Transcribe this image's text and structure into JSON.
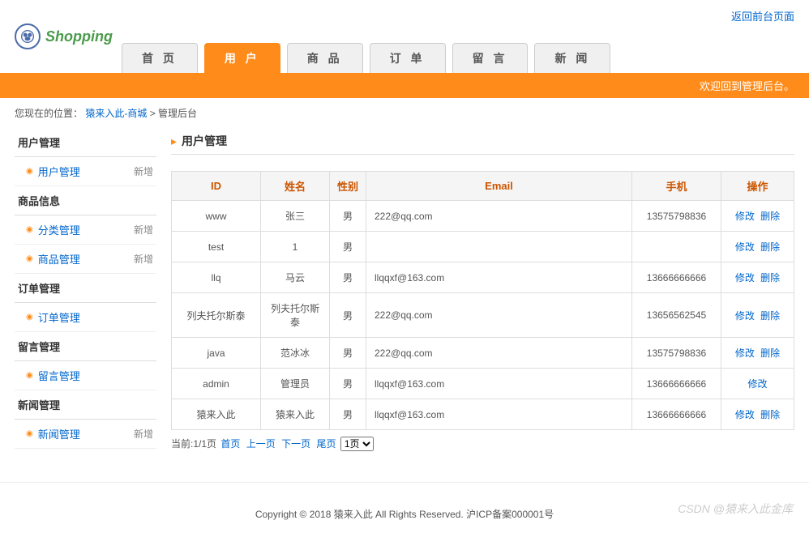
{
  "topLink": "返回前台页面",
  "logo": {
    "text": "Shopping"
  },
  "nav": {
    "tabs": [
      {
        "label": "首 页",
        "active": false
      },
      {
        "label": "用 户",
        "active": true
      },
      {
        "label": "商 品",
        "active": false
      },
      {
        "label": "订 单",
        "active": false
      },
      {
        "label": "留 言",
        "active": false
      },
      {
        "label": "新 闻",
        "active": false
      }
    ]
  },
  "welcomeBar": "欢迎回到管理后台。",
  "breadcrumb": {
    "prefix": "您现在的位置：",
    "link": "猿来入此-商城",
    "sep": " > ",
    "current": "管理后台"
  },
  "sidebar": [
    {
      "title": "用户管理",
      "items": [
        {
          "label": "用户管理",
          "add": "新增"
        }
      ]
    },
    {
      "title": "商品信息",
      "items": [
        {
          "label": "分类管理",
          "add": "新增"
        },
        {
          "label": "商品管理",
          "add": "新增"
        }
      ]
    },
    {
      "title": "订单管理",
      "items": [
        {
          "label": "订单管理",
          "add": ""
        }
      ]
    },
    {
      "title": "留言管理",
      "items": [
        {
          "label": "留言管理",
          "add": ""
        }
      ]
    },
    {
      "title": "新闻管理",
      "items": [
        {
          "label": "新闻管理",
          "add": "新增"
        }
      ]
    }
  ],
  "pageTitle": "用户管理",
  "table": {
    "headers": [
      "ID",
      "姓名",
      "性别",
      "Email",
      "手机",
      "操作"
    ],
    "rows": [
      {
        "id": "www",
        "name": "张三",
        "gender": "男",
        "email": "222@qq.com",
        "phone": "13575798836",
        "ops": [
          "修改",
          "删除"
        ]
      },
      {
        "id": "test",
        "name": "1",
        "gender": "男",
        "email": "",
        "phone": "",
        "ops": [
          "修改",
          "删除"
        ]
      },
      {
        "id": "llq",
        "name": "马云",
        "gender": "男",
        "email": "llqqxf@163.com",
        "phone": "13666666666",
        "ops": [
          "修改",
          "删除"
        ]
      },
      {
        "id": "列夫托尔斯泰",
        "name": "列夫托尔斯泰",
        "gender": "男",
        "email": "222@qq.com",
        "phone": "13656562545",
        "ops": [
          "修改",
          "删除"
        ]
      },
      {
        "id": "java",
        "name": "范冰冰",
        "gender": "男",
        "email": "222@qq.com",
        "phone": "13575798836",
        "ops": [
          "修改",
          "删除"
        ]
      },
      {
        "id": "admin",
        "name": "管理员",
        "gender": "男",
        "email": "llqqxf@163.com",
        "phone": "13666666666",
        "ops": [
          "修改"
        ]
      },
      {
        "id": "猿来入此",
        "name": "猿来入此",
        "gender": "男",
        "email": "llqqxf@163.com",
        "phone": "13666666666",
        "ops": [
          "修改",
          "删除"
        ]
      }
    ]
  },
  "pagination": {
    "text": "当前:1/1页",
    "first": "首页",
    "prev": "上一页",
    "next": "下一页",
    "last": "尾页",
    "select": "1页"
  },
  "footer": "Copyright © 2018 猿来入此 All Rights Reserved. 沪ICP备案000001号",
  "watermark": "CSDN @猿来入此金库"
}
